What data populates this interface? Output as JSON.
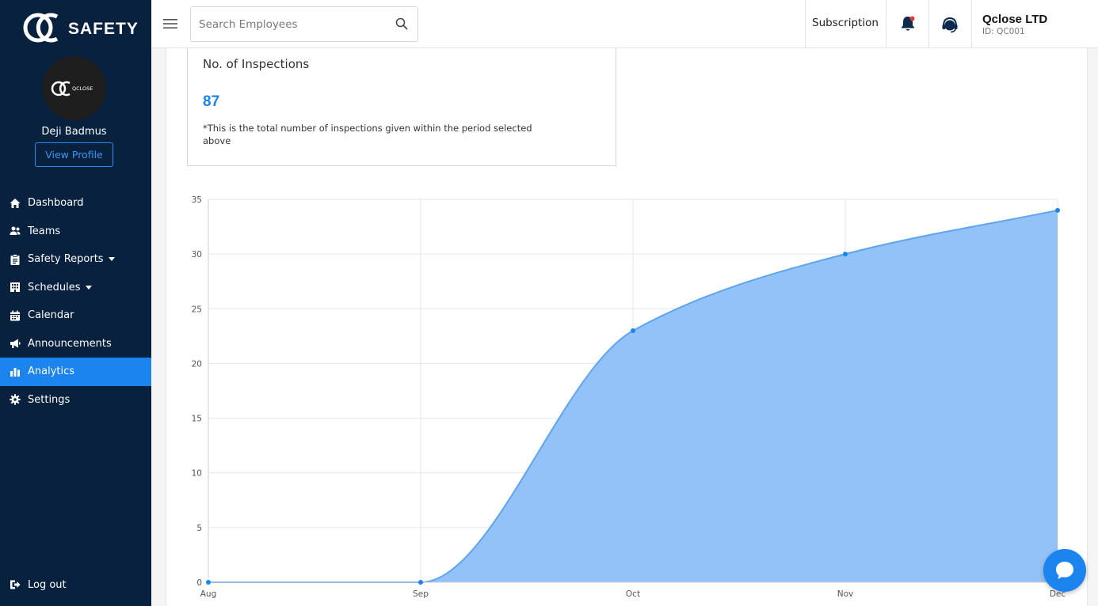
{
  "brand": {
    "name": "SAFETY",
    "logo_icon": "qc-logo-icon",
    "avatar_logo_text": "QCLOSE"
  },
  "user": {
    "name": "Deji Badmus",
    "view_profile_label": "View Profile"
  },
  "sidebar": {
    "items": [
      {
        "label": "Dashboard",
        "icon": "home-icon"
      },
      {
        "label": "Teams",
        "icon": "users-icon"
      },
      {
        "label": "Safety Reports",
        "icon": "clipboard-icon",
        "has_dropdown": true
      },
      {
        "label": "Schedules",
        "icon": "building-icon",
        "has_dropdown": true
      },
      {
        "label": "Calendar",
        "icon": "calendar-icon"
      },
      {
        "label": "Announcements",
        "icon": "megaphone-icon"
      },
      {
        "label": "Analytics",
        "icon": "bar-chart-icon",
        "active": true
      },
      {
        "label": "Settings",
        "icon": "gear-icon"
      }
    ],
    "logout_label": "Log out"
  },
  "topbar": {
    "search_placeholder": "Search Employees",
    "subscription_label": "Subscription",
    "company_name": "Qclose LTD",
    "company_id": "ID: QC001"
  },
  "stat": {
    "title": "No. of Inspections",
    "value": "87",
    "note": "*This is the total number of inspections given within the period selected above"
  },
  "colors": {
    "sidebar": "#07213f",
    "accent": "#1c84ee",
    "area_fill": "#8cbff7"
  },
  "chart_data": {
    "type": "area",
    "categories": [
      "Aug",
      "Sep",
      "Oct",
      "Nov",
      "Dec"
    ],
    "values": [
      0,
      0,
      23,
      30,
      34
    ],
    "ylim": [
      0,
      35
    ],
    "yticks": [
      0,
      5,
      10,
      15,
      20,
      25,
      30,
      35
    ],
    "grid": true,
    "smooth": true
  }
}
